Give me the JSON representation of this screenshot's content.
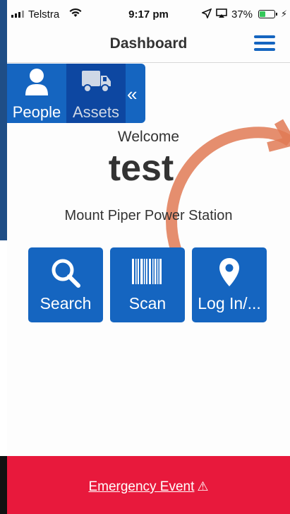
{
  "status_bar": {
    "carrier": "Telstra",
    "time": "9:17 pm",
    "battery_percent": "37%",
    "battery_level": 0.37,
    "icons": [
      "signal-icon",
      "wifi-icon",
      "location-arrow-icon",
      "airplay-icon",
      "battery-icon",
      "charging-bolt-icon"
    ]
  },
  "header": {
    "title": "Dashboard",
    "menu_icon": "hamburger-menu-icon"
  },
  "side_tabs": {
    "items": [
      {
        "label": "People",
        "icon": "person-icon"
      },
      {
        "label": "Assets",
        "icon": "truck-icon"
      }
    ],
    "collapse_symbol": "«"
  },
  "main": {
    "welcome": "Welcome",
    "username": "test",
    "site": "Mount Piper Power Station",
    "actions": [
      {
        "label": "Search",
        "icon": "search-icon"
      },
      {
        "label": "Scan",
        "icon": "barcode-icon"
      },
      {
        "label": "Log In/...",
        "icon": "map-pin-icon"
      }
    ]
  },
  "footer": {
    "emergency_label": "Emergency Event",
    "warning_symbol": "⚠"
  },
  "colors": {
    "primary": "#1565c0",
    "primary_dark": "#0d47a1",
    "emergency": "#e8193c",
    "swipe_arc": "#e07a55"
  }
}
